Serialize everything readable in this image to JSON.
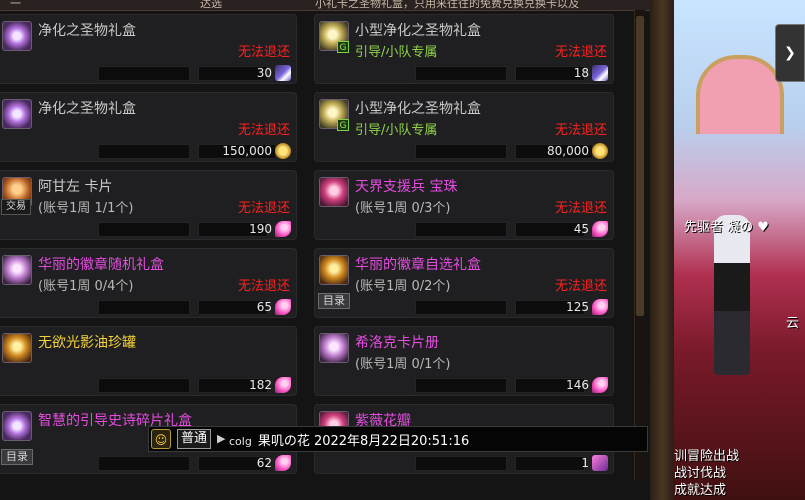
{
  "top_strip": {
    "left": "一",
    "mid": "达选",
    "right": "小礼卡之圣物礼盒，只用来往往的免费兑换兑换卡以及"
  },
  "items": [
    {
      "name": "净化之圣物礼盒",
      "sub": "",
      "refund": "无法退还",
      "price": "30",
      "currency_icon": "gem-icon",
      "icon": "purple",
      "name_color": "gray",
      "badge": ""
    },
    {
      "name": "小型净化之圣物礼盒",
      "sub": "引导/小队专属",
      "refund": "无法退还",
      "price": "18",
      "currency_icon": "gem-icon",
      "icon": "green",
      "name_color": "gray",
      "badge": "G"
    },
    {
      "name": "净化之圣物礼盒",
      "sub": "",
      "refund": "无法退还",
      "price": "150,000",
      "currency_icon": "gold-coin-icon",
      "icon": "purple",
      "name_color": "gray",
      "badge": ""
    },
    {
      "name": "小型净化之圣物礼盒",
      "sub": "引导/小队专属",
      "refund": "无法退还",
      "price": "80,000",
      "currency_icon": "gold-coin-icon",
      "icon": "green",
      "name_color": "gray",
      "badge": "G"
    },
    {
      "name": "阿甘左  卡片",
      "sub": "(账号1周 1/1个)",
      "refund": "无法退还",
      "price": "190",
      "currency_icon": "petal-icon",
      "icon": "orange",
      "name_color": "gray",
      "badge": "交易"
    },
    {
      "name": "天界支援兵  宝珠",
      "sub": "(账号1周 0/3个)",
      "refund": "无法退还",
      "price": "45",
      "currency_icon": "petal-icon",
      "icon": "pink",
      "name_color": "mag",
      "badge": ""
    },
    {
      "name": "华丽的徽章随机礼盒",
      "sub": "(账号1周 0/4个)",
      "refund": "无法退还",
      "price": "65",
      "currency_icon": "petal-icon",
      "icon": "lilac",
      "name_color": "mag",
      "badge": ""
    },
    {
      "name": "华丽的徽章自选礼盒",
      "sub": "(账号1周 0/2个)",
      "refund": "无法退还",
      "price": "125",
      "currency_icon": "petal-icon",
      "icon": "gold",
      "name_color": "mag",
      "badge": "",
      "list_tag": "目录"
    },
    {
      "name": "无欲光影油珍罐",
      "sub": "",
      "refund": "",
      "price": "182",
      "currency_icon": "petal-icon",
      "icon": "gold",
      "name_color": "yel",
      "badge": ""
    },
    {
      "name": "希洛克卡片册",
      "sub": "(账号1周 0/1个)",
      "refund": "",
      "price": "146",
      "currency_icon": "petal-icon",
      "icon": "lilac",
      "name_color": "mag",
      "badge": ""
    },
    {
      "name": "智慧的引导史诗碎片礼盒",
      "sub": "",
      "refund": "",
      "price": "62",
      "currency_icon": "petal-icon",
      "icon": "purple",
      "name_color": "mag",
      "badge": "",
      "list_tag": "目录"
    },
    {
      "name": "紫薇花瓣",
      "sub": "",
      "refund": "",
      "price": "1",
      "currency_icon": "square-icon",
      "icon": "pink",
      "name_color": "mag",
      "badge": ""
    }
  ],
  "chat": {
    "channel": "普通",
    "user": "colg",
    "message": "果叽の花 2022年8月22日20:51:16"
  },
  "game": {
    "npc_name": "先驱者 凝の ♥",
    "side_arrow": "❯",
    "cloud_label": "云",
    "bottom_text": "训冒险出战\n战讨伐战\n成就达成"
  }
}
